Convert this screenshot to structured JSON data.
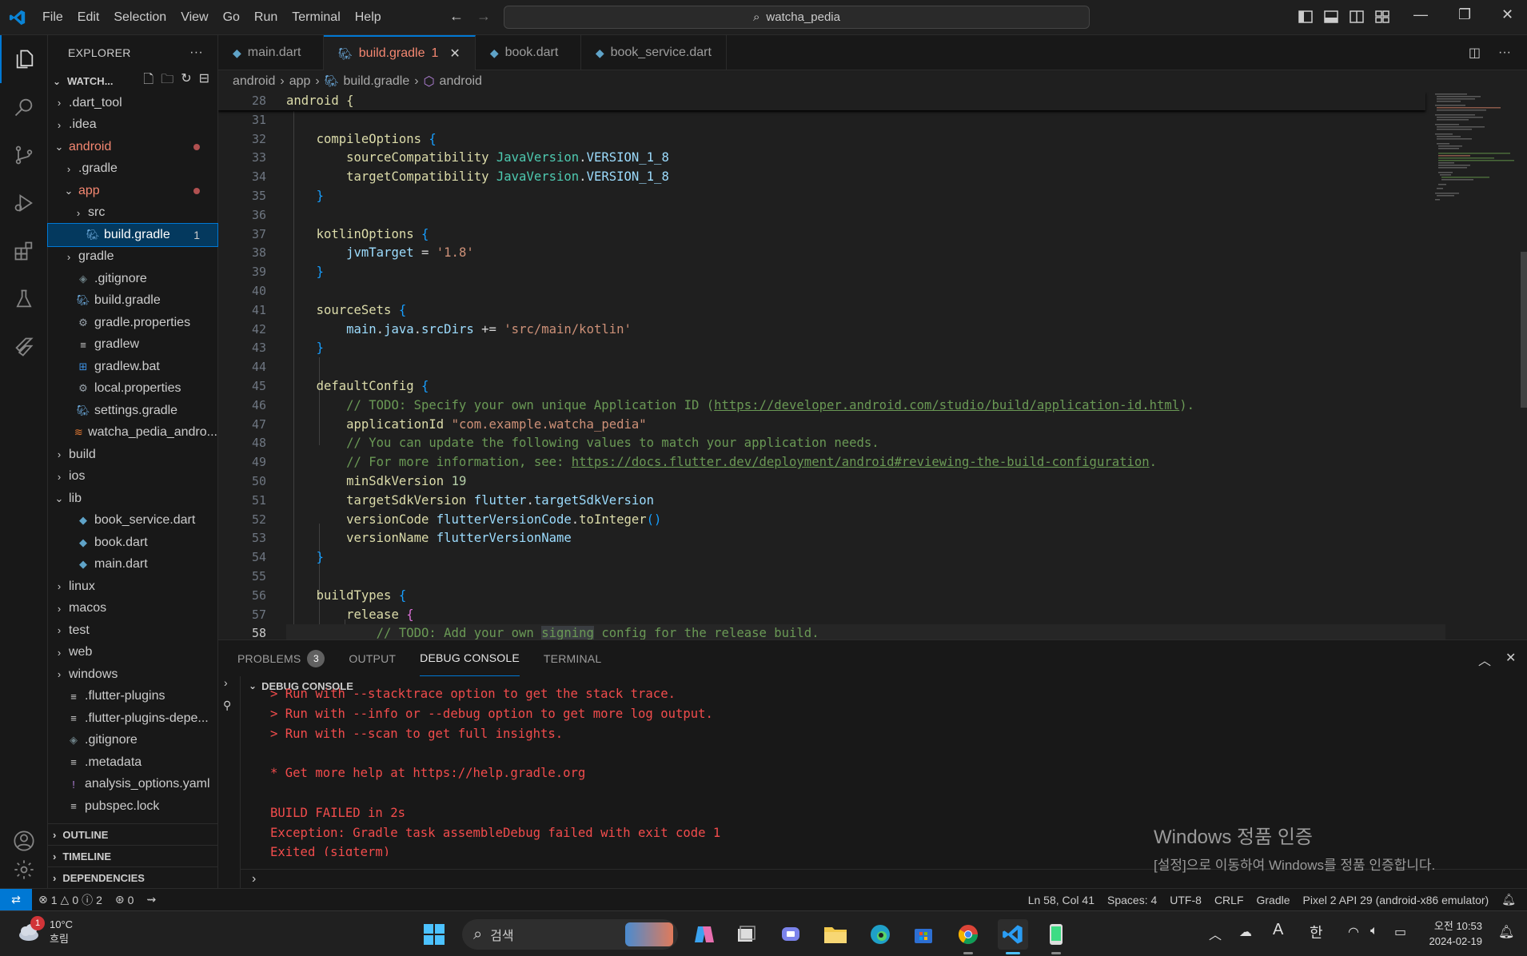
{
  "menu": [
    "File",
    "Edit",
    "Selection",
    "View",
    "Go",
    "Run",
    "Terminal",
    "Help"
  ],
  "search_text": "watcha_pedia",
  "explorer": {
    "title": "EXPLORER",
    "root": "WATCH...",
    "items": [
      {
        "label": ".dart_tool",
        "indent": 0,
        "type": "folder",
        "open": false
      },
      {
        "label": ".idea",
        "indent": 0,
        "type": "folder",
        "open": false
      },
      {
        "label": "android",
        "indent": 0,
        "type": "folder",
        "open": true,
        "modified": true
      },
      {
        "label": ".gradle",
        "indent": 1,
        "type": "folder",
        "open": false
      },
      {
        "label": "app",
        "indent": 1,
        "type": "folder",
        "open": true,
        "modified": true
      },
      {
        "label": "src",
        "indent": 2,
        "type": "folder",
        "open": false
      },
      {
        "label": "build.gradle",
        "indent": 2,
        "type": "gradle",
        "selected": true,
        "problems": "1"
      },
      {
        "label": "gradle",
        "indent": 1,
        "type": "folder",
        "open": false
      },
      {
        "label": ".gitignore",
        "indent": 1,
        "type": "git"
      },
      {
        "label": "build.gradle",
        "indent": 1,
        "type": "gradle"
      },
      {
        "label": "gradle.properties",
        "indent": 1,
        "type": "gear"
      },
      {
        "label": "gradlew",
        "indent": 1,
        "type": "lines"
      },
      {
        "label": "gradlew.bat",
        "indent": 1,
        "type": "win"
      },
      {
        "label": "local.properties",
        "indent": 1,
        "type": "gear"
      },
      {
        "label": "settings.gradle",
        "indent": 1,
        "type": "gradle"
      },
      {
        "label": "watcha_pedia_andro...",
        "indent": 1,
        "type": "rss"
      },
      {
        "label": "build",
        "indent": 0,
        "type": "folder",
        "open": false
      },
      {
        "label": "ios",
        "indent": 0,
        "type": "folder",
        "open": false
      },
      {
        "label": "lib",
        "indent": 0,
        "type": "folder",
        "open": true
      },
      {
        "label": "book_service.dart",
        "indent": 1,
        "type": "dart"
      },
      {
        "label": "book.dart",
        "indent": 1,
        "type": "dart"
      },
      {
        "label": "main.dart",
        "indent": 1,
        "type": "dart"
      },
      {
        "label": "linux",
        "indent": 0,
        "type": "folder",
        "open": false
      },
      {
        "label": "macos",
        "indent": 0,
        "type": "folder",
        "open": false
      },
      {
        "label": "test",
        "indent": 0,
        "type": "folder",
        "open": false
      },
      {
        "label": "web",
        "indent": 0,
        "type": "folder",
        "open": false
      },
      {
        "label": "windows",
        "indent": 0,
        "type": "folder",
        "open": false
      },
      {
        "label": ".flutter-plugins",
        "indent": 0,
        "type": "lines"
      },
      {
        "label": ".flutter-plugins-depe...",
        "indent": 0,
        "type": "lines"
      },
      {
        "label": ".gitignore",
        "indent": 0,
        "type": "git"
      },
      {
        "label": ".metadata",
        "indent": 0,
        "type": "lines"
      },
      {
        "label": "analysis_options.yaml",
        "indent": 0,
        "type": "excl"
      },
      {
        "label": "pubspec.lock",
        "indent": 0,
        "type": "lines"
      }
    ],
    "sections": [
      "OUTLINE",
      "TIMELINE",
      "DEPENDENCIES"
    ]
  },
  "tabs": [
    {
      "label": "main.dart",
      "icon": "dart",
      "active": false
    },
    {
      "label": "build.gradle",
      "icon": "gradle",
      "active": true,
      "badge": "1"
    },
    {
      "label": "book.dart",
      "icon": "dart",
      "active": false
    },
    {
      "label": "book_service.dart",
      "icon": "dart",
      "active": false
    }
  ],
  "breadcrumb": [
    "android",
    "app",
    "build.gradle",
    "android"
  ],
  "editor": {
    "sticky_line": "28",
    "sticky_text": "android {",
    "line_numbers": [
      "31",
      "32",
      "33",
      "34",
      "35",
      "36",
      "37",
      "38",
      "39",
      "40",
      "41",
      "42",
      "43",
      "44",
      "45",
      "46",
      "47",
      "48",
      "49",
      "50",
      "51",
      "52",
      "53",
      "54",
      "55",
      "56",
      "57",
      "58"
    ],
    "current_line": "58"
  },
  "panel": {
    "tabs": [
      {
        "label": "PROBLEMS",
        "count": "3"
      },
      {
        "label": "OUTPUT"
      },
      {
        "label": "DEBUG CONSOLE",
        "active": true
      },
      {
        "label": "TERMINAL"
      }
    ],
    "section": "DEBUG CONSOLE",
    "output": [
      "> Run with --stacktrace option to get the stack trace.",
      "> Run with --info or --debug option to get more log output.",
      "> Run with --scan to get full insights.",
      "",
      "* Get more help at https://help.gradle.org",
      "",
      "BUILD FAILED in 2s",
      "Exception: Gradle task assembleDebug failed with exit code 1",
      "Exited (sigterm)"
    ]
  },
  "watermark": {
    "line1": "Windows 정품 인증",
    "line2": "[설정]으로 이동하여 Windows를 정품 인증합니다."
  },
  "status": {
    "errors": "1",
    "warnings": "0",
    "infos": "2",
    "ports": "0",
    "position": "Ln 58, Col 41",
    "spaces": "Spaces: 4",
    "encoding": "UTF-8",
    "eol": "CRLF",
    "language": "Gradle",
    "device": "Pixel 2 API 29 (android-x86 emulator)"
  },
  "taskbar": {
    "temp": "10°C",
    "weather": "흐림",
    "weather_badge": "1",
    "search": "검색",
    "ime_a": "A",
    "ime_k": "한",
    "time": "오전 10:53",
    "date": "2024-02-19"
  },
  "colors": {
    "accent": "#0078d4",
    "error": "#f14c4c",
    "string": "#ce9178",
    "comment": "#6a9955"
  }
}
